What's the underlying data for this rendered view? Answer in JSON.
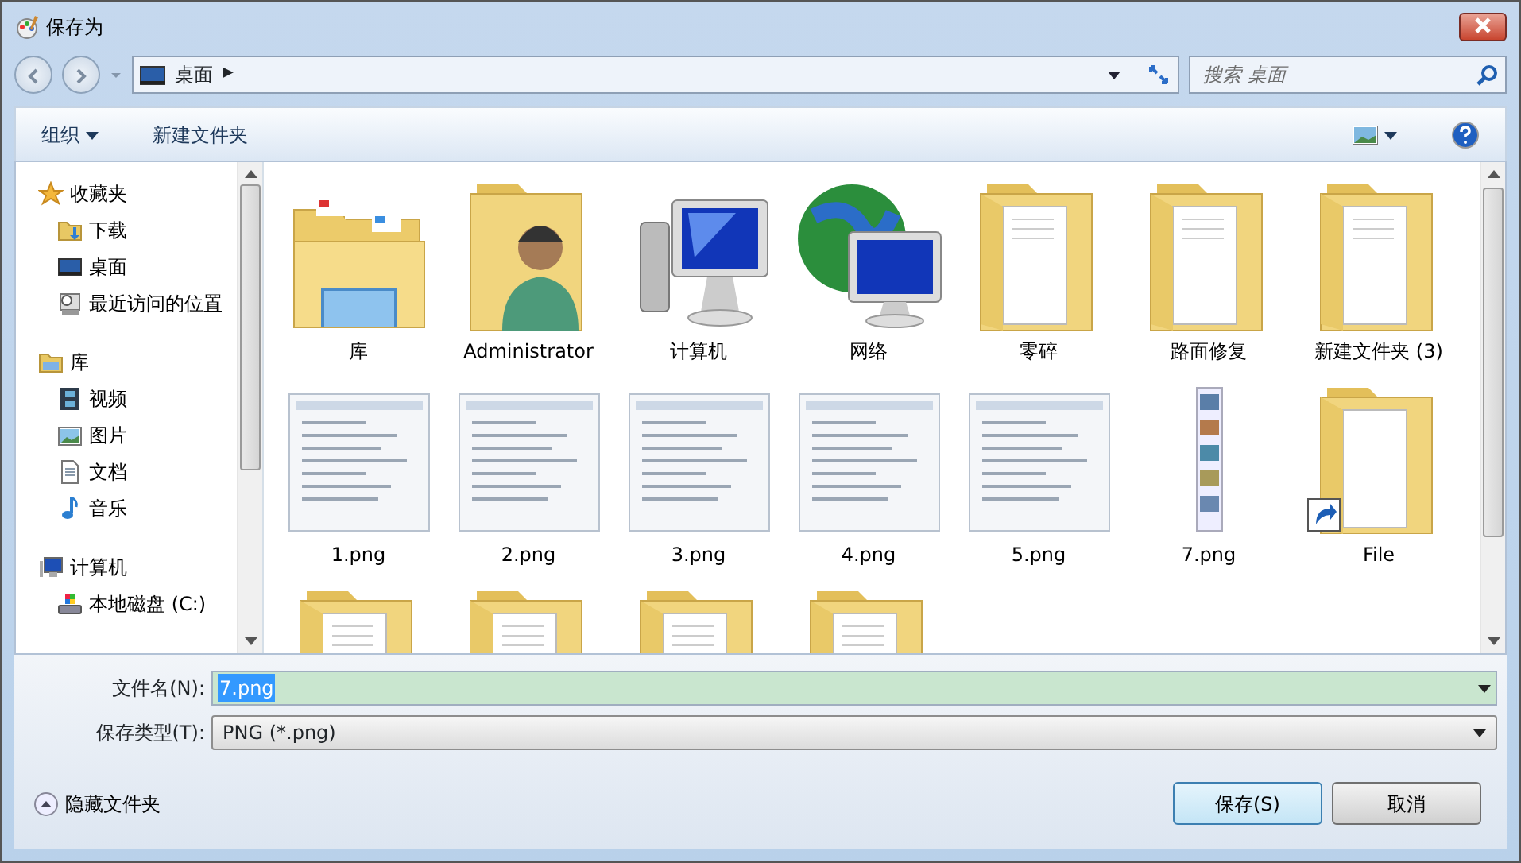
{
  "window": {
    "title": "保存为"
  },
  "address": {
    "location": "桌面",
    "separator": "▶"
  },
  "search": {
    "placeholder": "搜索 桌面"
  },
  "toolbar": {
    "organize": "组织",
    "new_folder": "新建文件夹"
  },
  "sidebar": {
    "groups": [
      {
        "label": "收藏夹",
        "kind": "favorites",
        "children": [
          {
            "label": "下载",
            "kind": "downloads"
          },
          {
            "label": "桌面",
            "kind": "desktop"
          },
          {
            "label": "最近访问的位置",
            "kind": "recent"
          }
        ]
      },
      {
        "label": "库",
        "kind": "library",
        "children": [
          {
            "label": "视频",
            "kind": "video"
          },
          {
            "label": "图片",
            "kind": "pictures"
          },
          {
            "label": "文档",
            "kind": "documents"
          },
          {
            "label": "音乐",
            "kind": "music"
          }
        ]
      },
      {
        "label": "计算机",
        "kind": "computer",
        "children": [
          {
            "label": "本地磁盘 (C:)",
            "kind": "disk"
          }
        ]
      }
    ]
  },
  "items": [
    {
      "label": "库",
      "kind": "library"
    },
    {
      "label": "Administrator",
      "kind": "user"
    },
    {
      "label": "计算机",
      "kind": "computer"
    },
    {
      "label": "网络",
      "kind": "network"
    },
    {
      "label": "零碎",
      "kind": "folder"
    },
    {
      "label": "路面修复",
      "kind": "folder"
    },
    {
      "label": "新建文件夹 (3)",
      "kind": "folder"
    },
    {
      "label": "1.png",
      "kind": "image"
    },
    {
      "label": "2.png",
      "kind": "image"
    },
    {
      "label": "3.png",
      "kind": "image"
    },
    {
      "label": "4.png",
      "kind": "image"
    },
    {
      "label": "5.png",
      "kind": "image"
    },
    {
      "label": "7.png",
      "kind": "tall-image"
    },
    {
      "label": "File",
      "kind": "shortcut"
    },
    {
      "kind": "folder"
    },
    {
      "kind": "folder"
    },
    {
      "kind": "folder"
    },
    {
      "kind": "folder"
    }
  ],
  "filename": {
    "label": "文件名(N):",
    "value": "7.png"
  },
  "filetype": {
    "label": "保存类型(T):",
    "value": "PNG (*.png)"
  },
  "hide_folders": "隐藏文件夹",
  "buttons": {
    "save": "保存(S)",
    "cancel": "取消"
  }
}
